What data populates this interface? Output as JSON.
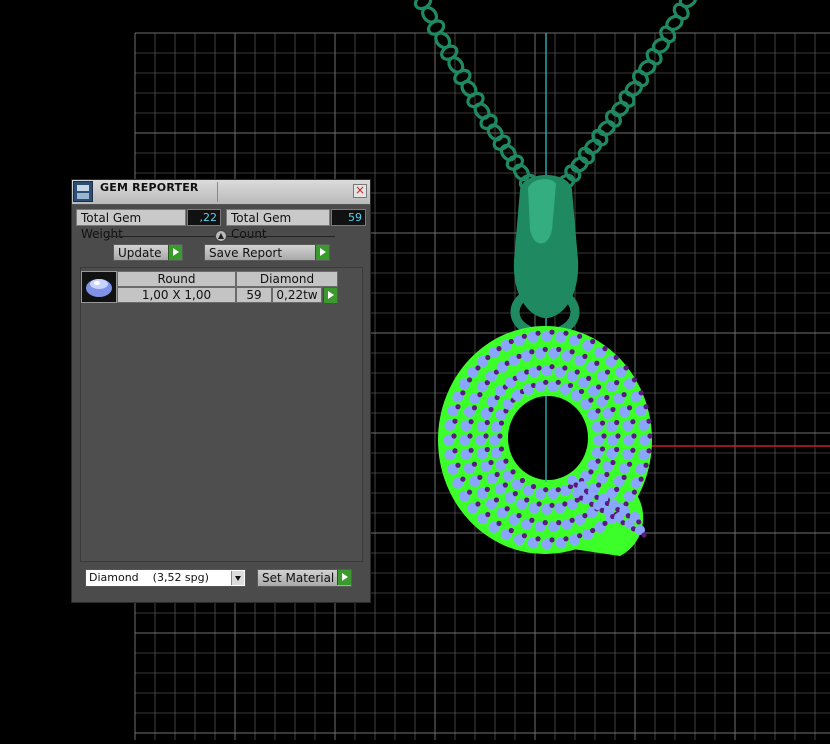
{
  "panel": {
    "title": "GEM REPORTER",
    "total_gem_weight_label": "Total Gem Weight",
    "total_gem_weight_value": ",22",
    "total_gem_count_label": "Total Gem Count",
    "total_gem_count_value": "59",
    "update_label": "Update",
    "save_report_label": "Save Report",
    "gem_list": [
      {
        "icon": "round-diamond-icon",
        "cut": "Round",
        "material": "Diamond",
        "size": "1,00 X 1,00",
        "count": "59",
        "weight": "0,22tw"
      }
    ],
    "material_select_value": "Diamond    (3,52 spg)",
    "set_material_label": "Set Material"
  },
  "viewport": {
    "object_color": "#1f8a62",
    "highlight_color": "#3cff2a",
    "gem_stone_color": "#8aa6ff",
    "gem_prong_color": "#5b1a80",
    "axis_y_color": "#2aa6a6",
    "axis_x_color": "#c42020",
    "grid_color": "#6e6e6e"
  }
}
